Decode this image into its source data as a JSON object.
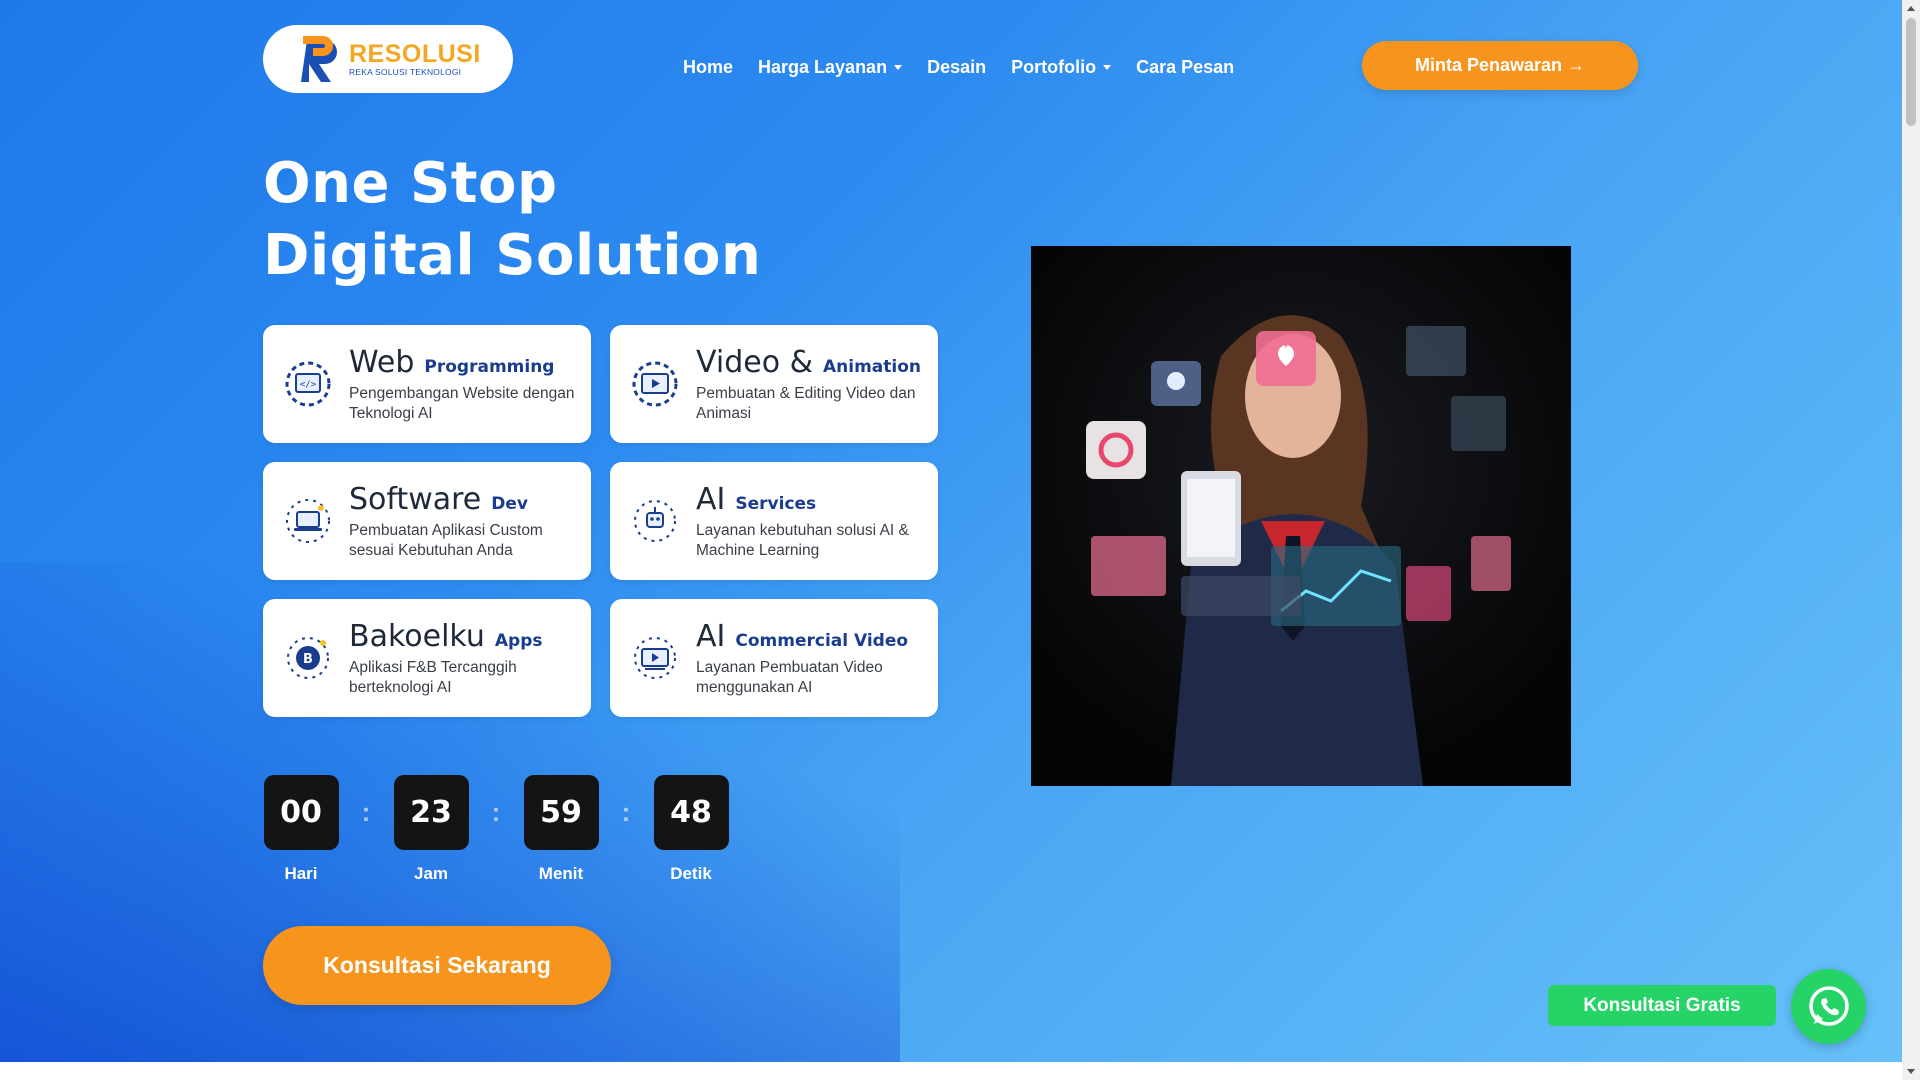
{
  "header": {
    "logo": {
      "title": "RESOLUSI",
      "subtitle": "REKA SOLUSI TEKNOLOGI"
    },
    "nav": [
      {
        "label": "Home",
        "dropdown": false
      },
      {
        "label": "Harga Layanan",
        "dropdown": true
      },
      {
        "label": "Desain",
        "dropdown": false
      },
      {
        "label": "Portofolio",
        "dropdown": true
      },
      {
        "label": "Cara Pesan",
        "dropdown": false
      }
    ],
    "cta_label": "Minta Penawaran →"
  },
  "hero": {
    "headline_line1": "One Stop",
    "headline_line2": "Digital Solution",
    "cards": [
      {
        "title": "Web",
        "accent": "Programming",
        "desc": "Pengembangan Website dengan Teknologi AI",
        "icon": "web-programming-icon"
      },
      {
        "title": "Video &",
        "accent": "Animation",
        "desc": "Pembuatan & Editing Video dan Animasi",
        "icon": "video-animation-icon"
      },
      {
        "title": "Software",
        "accent": "Dev",
        "desc": "Pembuatan Aplikasi Custom sesuai Kebutuhan Anda",
        "icon": "software-dev-icon"
      },
      {
        "title": "AI",
        "accent": "Services",
        "desc": "Layanan kebutuhan solusi AI & Machine Learning",
        "icon": "ai-services-icon"
      },
      {
        "title": "Bakoelku",
        "accent": "Apps",
        "desc": "Aplikasi F&B Tercanggih berteknologi AI",
        "icon": "bakoelku-apps-icon"
      },
      {
        "title": "AI",
        "accent": "Commercial Video",
        "desc": "Layanan Pembuatan Video menggunakan AI",
        "icon": "ai-commercial-video-icon"
      }
    ],
    "countdown": {
      "days": {
        "value": "00",
        "label": "Hari"
      },
      "hours": {
        "value": "23",
        "label": "Jam"
      },
      "minutes": {
        "value": "59",
        "label": "Menit"
      },
      "seconds": {
        "value": "48",
        "label": "Detik"
      },
      "separator": ":"
    },
    "cta_label": "Konsultasi Sekarang"
  },
  "whatsapp": {
    "label": "Konsultasi Gratis",
    "icon": "whatsapp-icon"
  },
  "colors": {
    "accent_orange": "#f7941d",
    "hero_blue_start": "#1f78ea",
    "hero_blue_end": "#66c0f8",
    "card_accent": "#1a3d8f",
    "whatsapp_green": "#25d366"
  }
}
